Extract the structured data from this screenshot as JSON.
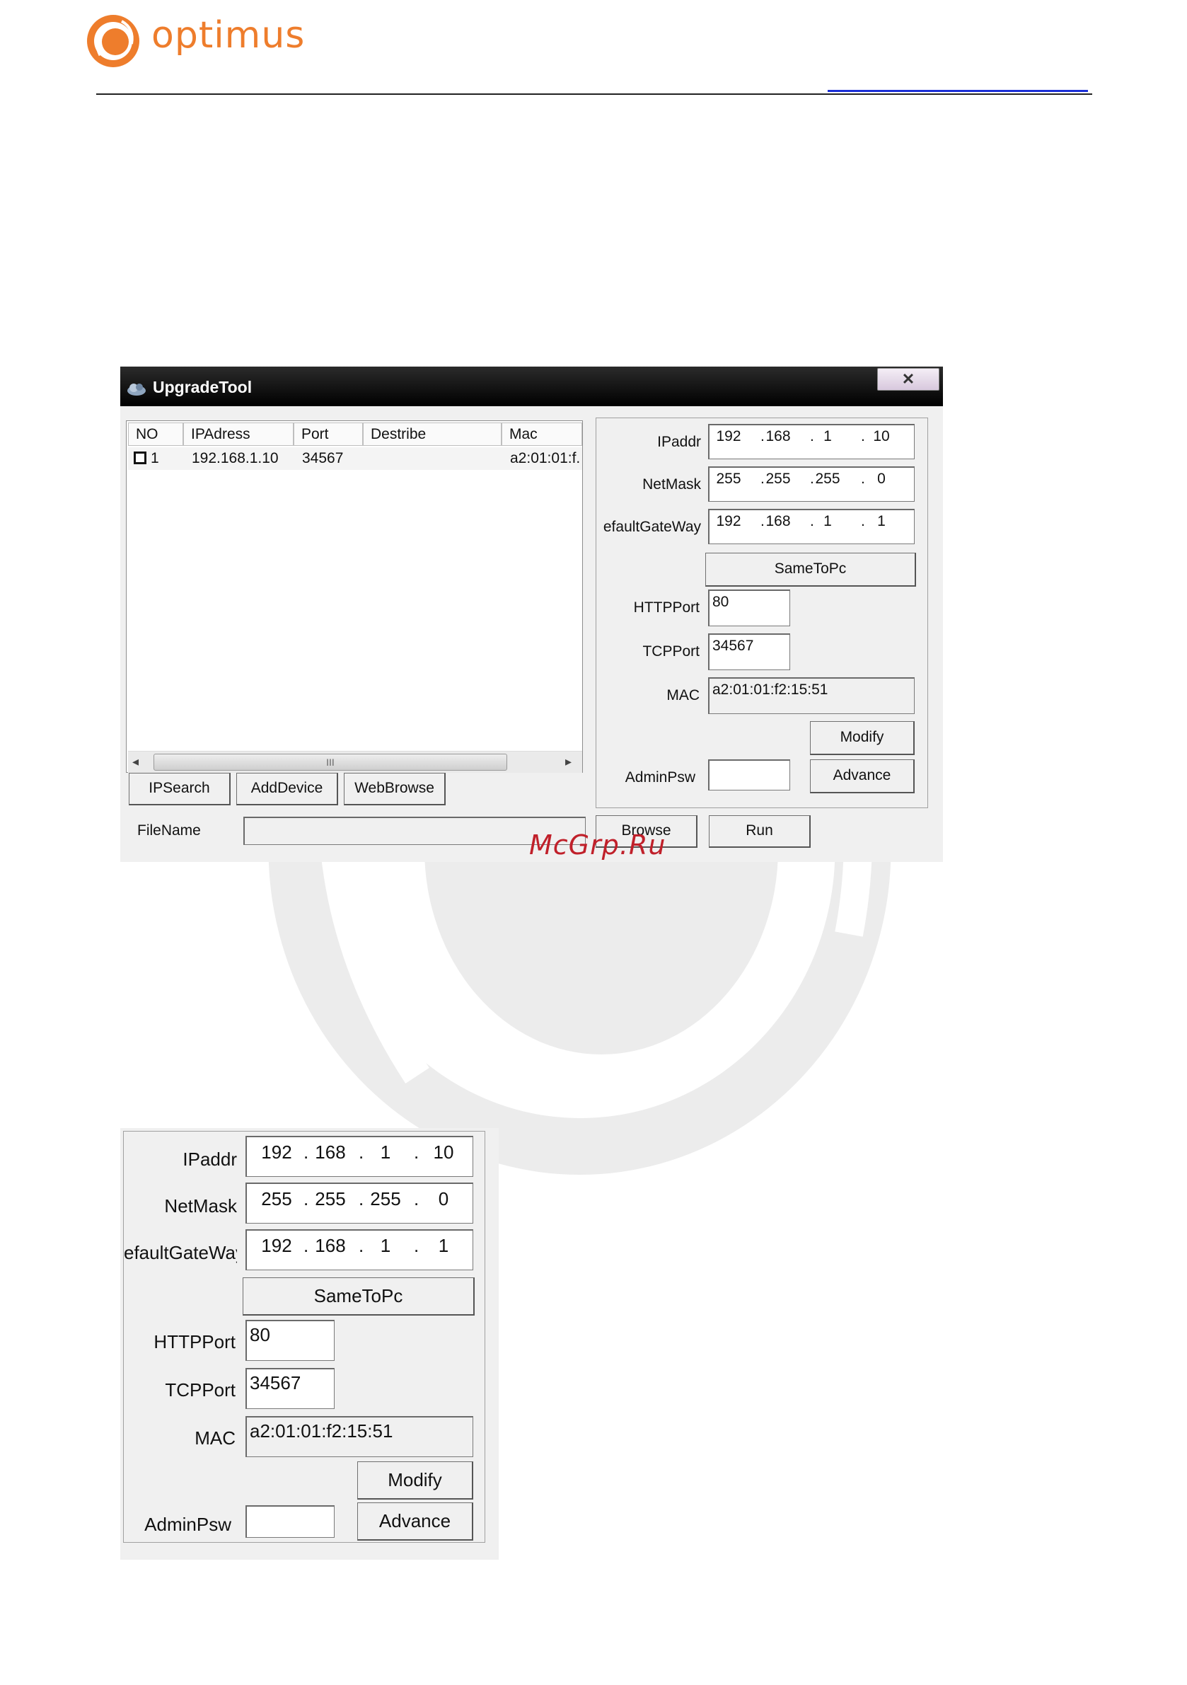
{
  "header": {
    "brand": "optimus"
  },
  "watermark": {
    "site": "McGrp.Ru"
  },
  "window": {
    "title": "UpgradeTool",
    "close_glyph": "✕",
    "device_list": {
      "columns": [
        "NO",
        "IPAdress",
        "Port",
        "Destribe",
        "Mac"
      ],
      "rows": [
        {
          "no": "1",
          "ip": "192.168.1.10",
          "port": "34567",
          "describe": "",
          "mac": "a2:01:01:f."
        }
      ],
      "scroll_grip": "III"
    },
    "buttons": {
      "ipsearch": "IPSearch",
      "adddevice": "AddDevice",
      "webbrowse": "WebBrowse",
      "browse": "Browse",
      "run": "Run"
    },
    "filename_label": "FileName",
    "filename_value": ""
  },
  "settings": {
    "ipaddr_label": "IPaddr",
    "ipaddr": [
      "192",
      "168",
      "1",
      "10"
    ],
    "netmask_label": "NetMask",
    "netmask": [
      "255",
      "255",
      "255",
      "0"
    ],
    "gateway_label": "efaultGateWay",
    "gateway": [
      "192",
      "168",
      "1",
      "1"
    ],
    "sametopc_label": "SameToPc",
    "httpport_label": "HTTPPort",
    "httpport": "80",
    "tcpport_label": "TCPPort",
    "tcpport": "34567",
    "mac_label": "MAC",
    "mac": "a2:01:01:f2:15:51",
    "modify_label": "Modify",
    "adminpsw_label": "AdminPsw",
    "adminpsw": "",
    "advance_label": "Advance"
  },
  "colors": {
    "brand_orange": "#ee7d2c",
    "watermark_red": "#c0202a",
    "link_blue": "#1a2fd6"
  }
}
